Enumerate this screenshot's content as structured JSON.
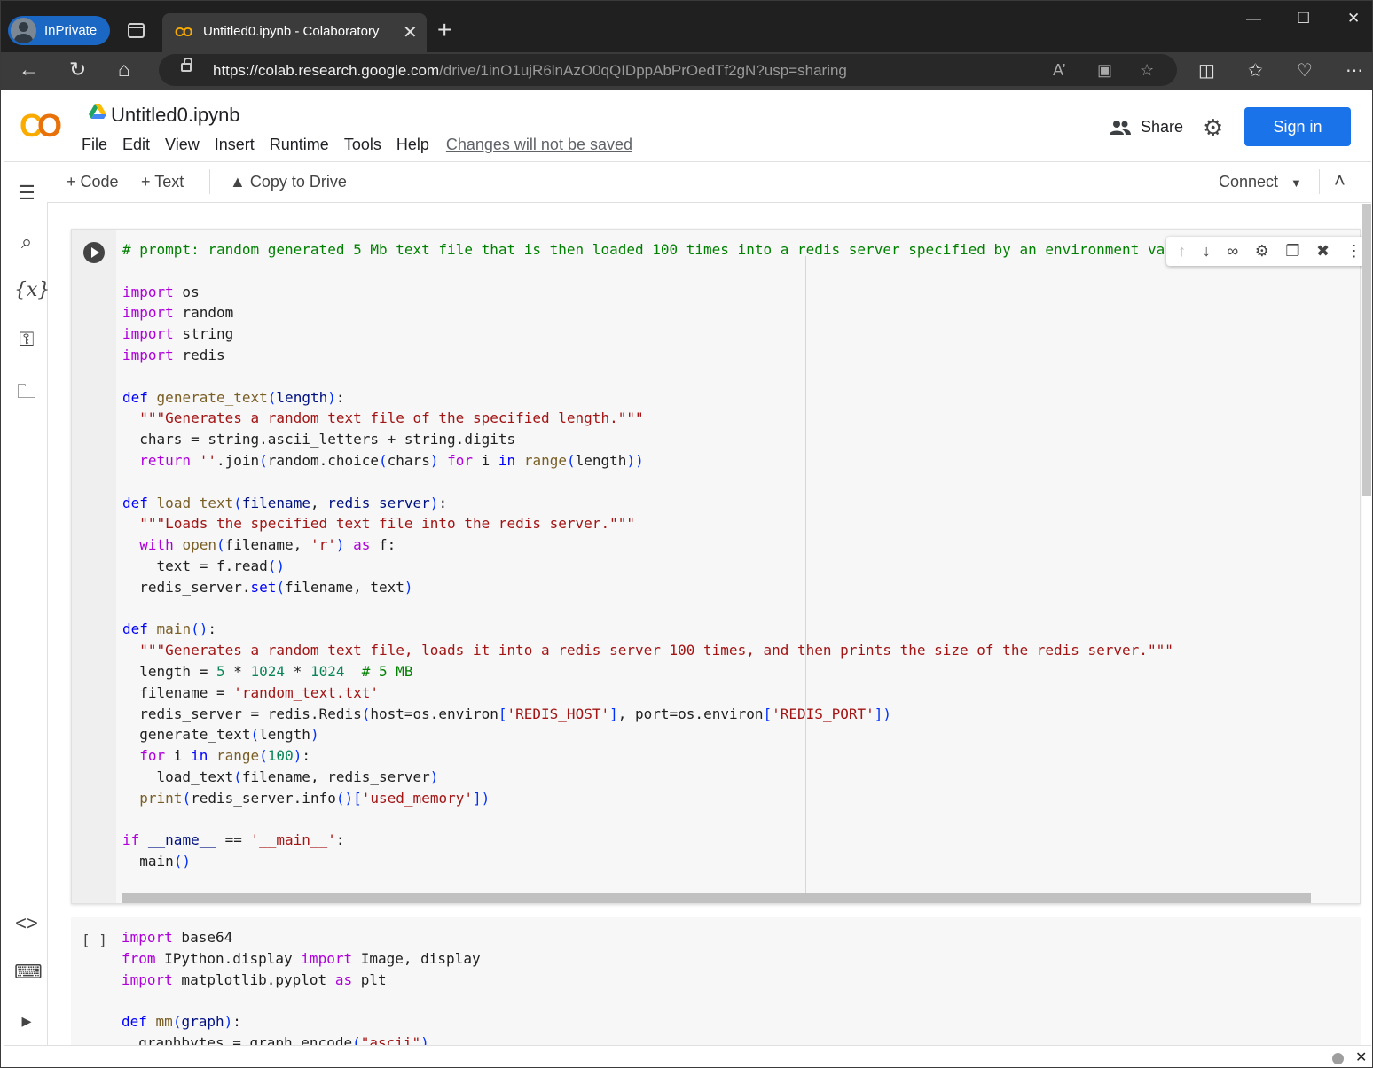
{
  "browser": {
    "inprivate_label": "InPrivate",
    "tab_title": "Untitled0.ipynb - Colaboratory",
    "tab_close": "✕",
    "new_tab": "+",
    "url_host": "https://colab.research.google.com",
    "url_path": "/drive/1inO1ujR6lnAzO0qQIDppAbPrOedTf2gN?usp=sharing",
    "window": {
      "minimize": "—",
      "maximize": "☐",
      "close": "✕"
    }
  },
  "colab": {
    "logo": "CO",
    "notebook_title": "Untitled0.ipynb",
    "menu": [
      "File",
      "Edit",
      "View",
      "Insert",
      "Runtime",
      "Tools",
      "Help"
    ],
    "unsaved_notice": "Changes will not be saved",
    "share_label": "Share",
    "signin_label": "Sign in",
    "toolbar": {
      "add_code": "+ Code",
      "add_text": "+ Text",
      "copy_to_drive": "Copy to Drive",
      "connect": "Connect"
    },
    "cell2_bracket": "[ ]"
  },
  "icons": {
    "back": "arrow-left-icon",
    "refresh": "refresh-icon",
    "home": "home-icon",
    "lock": "lock-icon",
    "read_aloud": "read-aloud-icon",
    "app_available": "app-icon",
    "favorite": "star-icon",
    "split_screen": "split-screen-icon",
    "favorites": "favorites-icon",
    "browser_essentials": "heart-pulse-icon",
    "more": "more-icon",
    "gear": "gear-icon",
    "toc": "table-of-contents-icon",
    "search": "search-icon",
    "variables": "variables-icon",
    "secrets": "key-icon",
    "files": "folder-icon",
    "code_snippets": "code-icon",
    "command_palette": "keyboard-icon",
    "terminal": "terminal-icon"
  },
  "colors": {
    "accent": "#1a73e8",
    "logo_yellow": "#f9ab00",
    "logo_orange": "#e8710a",
    "inprivate_blue": "#1b67c4"
  }
}
